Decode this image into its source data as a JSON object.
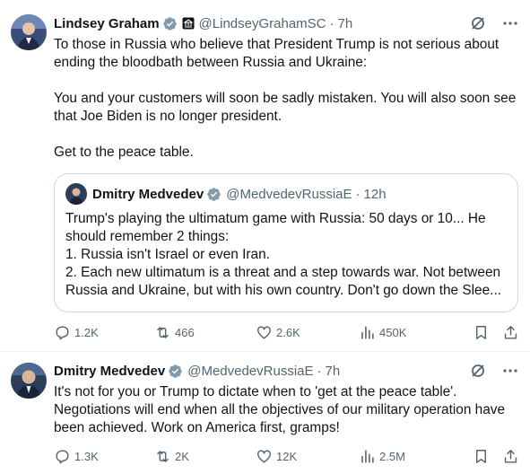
{
  "tweets": [
    {
      "author": {
        "name": "Lindsey Graham",
        "handle": "@LindseyGrahamSC",
        "time": "7h"
      },
      "text": "To those in Russia who believe that President Trump is not serious about ending the bloodbath between Russia and Ukraine:\n\nYou and your customers will soon be sadly mistaken. You will also soon see that Joe Biden is no longer president.\n\nGet to the peace table.",
      "quote": {
        "author": {
          "name": "Dmitry Medvedev",
          "handle": "@MedvedevRussiaE",
          "time": "12h"
        },
        "text": "Trump's playing the ultimatum game with Russia: 50 days or 10... He should remember 2 things:\n1. Russia isn't Israel or even Iran.\n2. Each new ultimatum is a threat and a step towards war. Not between Russia and Ukraine, but with his own country. Don't go down the Slee..."
      },
      "stats": {
        "replies": "1.2K",
        "reposts": "466",
        "likes": "2.6K",
        "views": "450K"
      }
    },
    {
      "author": {
        "name": "Dmitry Medvedev",
        "handle": "@MedvedevRussiaE",
        "time": "7h"
      },
      "text": "It's not for you or Trump to dictate when to 'get at the peace table'. Negotiations will end when all the objectives of our military operation have been achieved. Work on America first, gramps!",
      "stats": {
        "replies": "1.3K",
        "reposts": "2K",
        "likes": "12K",
        "views": "2.5M"
      }
    }
  ],
  "colors": {
    "text": "#0f1419",
    "secondary": "#536471",
    "verified": "#829aab",
    "border": "#cfd9de"
  },
  "icons": [
    "verified-badge-icon",
    "government-affiliation-icon",
    "grok-icon",
    "more-icon",
    "reply-icon",
    "repost-icon",
    "like-icon",
    "views-icon",
    "bookmark-icon",
    "share-icon"
  ]
}
